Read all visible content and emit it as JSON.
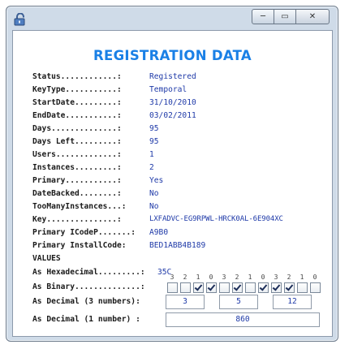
{
  "window": {
    "minimize_symbol": "─",
    "maximize_symbol": "▭",
    "close_symbol": "✕",
    "icon": "lock-icon"
  },
  "title": "REGISTRATION DATA",
  "fields": [
    {
      "label": "Status............:",
      "value": "Registered"
    },
    {
      "label": "KeyType...........:",
      "value": "Temporal"
    },
    {
      "label": "StartDate.........:",
      "value": "31/10/2010"
    },
    {
      "label": "EndDate...........:",
      "value": "03/02/2011"
    },
    {
      "label": "Days..............:",
      "value": "95"
    },
    {
      "label": "Days Left.........:",
      "value": "95"
    },
    {
      "label": "Users.............:",
      "value": "1"
    },
    {
      "label": "Instances.........:",
      "value": "2"
    },
    {
      "label": "Primary...........:",
      "value": "Yes"
    },
    {
      "label": "DateBacked........:",
      "value": "No"
    },
    {
      "label": "TooManyInstances...:",
      "value": "No"
    },
    {
      "label": "Key...............:",
      "value": "LXFADVC-EG9RPWL-HRCK0AL-6E904XC"
    },
    {
      "label": "Primary ICodeP.......:",
      "value": "A9B0"
    },
    {
      "label": "Primary InstallCode:",
      "value": "BED1ABB4B189"
    }
  ],
  "values_heading": "VALUES",
  "hexadecimal": {
    "label": "As Hexadecimal.........:",
    "value": "35C"
  },
  "binary": {
    "label": "As Binary..............:",
    "bit_numbers": [
      "3",
      "2",
      "1",
      "0",
      "3",
      "2",
      "1",
      "0",
      "3",
      "2",
      "1",
      "0"
    ],
    "checked": [
      false,
      false,
      true,
      true,
      false,
      true,
      false,
      true,
      true,
      true,
      false,
      false
    ]
  },
  "decimal3": {
    "label": "As Decimal (3 numbers):",
    "values": [
      "3",
      "5",
      "12"
    ]
  },
  "decimal1": {
    "label": "As Decimal (1 number) :",
    "value": "860"
  }
}
